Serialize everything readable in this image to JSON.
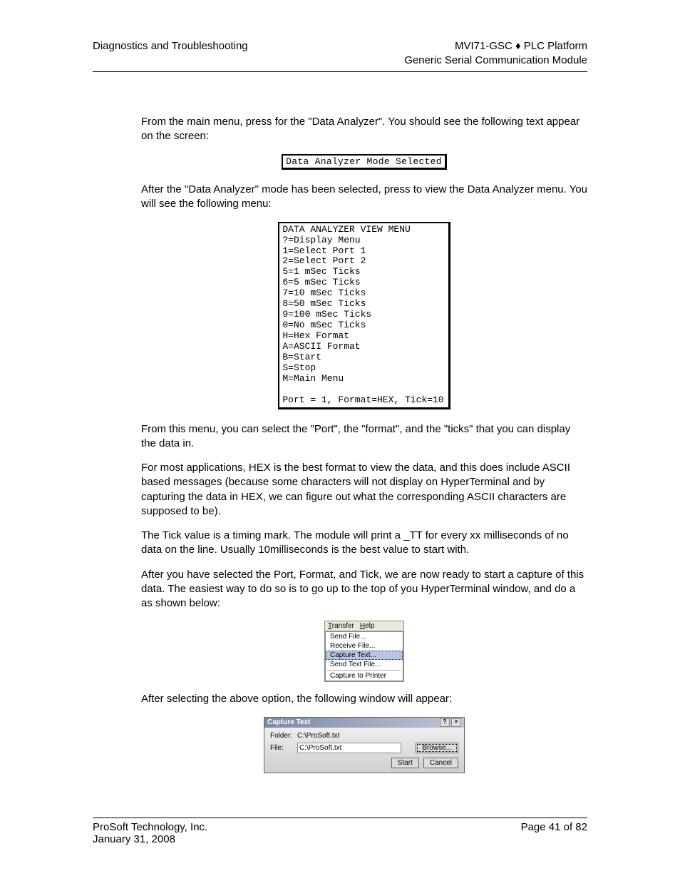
{
  "header": {
    "left": "Diagnostics and Troubleshooting",
    "right_line1": "MVI71-GSC ♦ PLC Platform",
    "right_line2": "Generic Serial Communication Module"
  },
  "para1": "From the main menu, press       for the \"Data Analyzer\". You should see the following text appear on the screen:",
  "terminal1": "Data Analyzer Mode Selected",
  "para2": "After the \"Data Analyzer\" mode has been selected, press       to view the Data Analyzer menu. You will see the following menu:",
  "menu_lines": [
    "DATA ANALYZER VIEW MENU",
    "?=Display Menu",
    "1=Select Port 1",
    "2=Select Port 2",
    "5=1 mSec Ticks",
    "6=5 mSec Ticks",
    "7=10 mSec Ticks",
    "8=50 mSec Ticks",
    "9=100 mSec Ticks",
    "0=No mSec Ticks",
    "H=Hex Format",
    "A=ASCII Format",
    "B=Start",
    "S=Stop",
    "M=Main Menu",
    "",
    "Port = 1, Format=HEX, Tick=10"
  ],
  "para3": "From this menu, you can select the \"Port\", the \"format\", and the \"ticks\" that you can display the data in.",
  "para4": "For most applications, HEX is the best format to view the data, and this does include ASCII based messages (because some characters will not display on HyperTerminal and by capturing the data in HEX, we can figure out what the corresponding ASCII characters are supposed to be).",
  "para5": "The Tick value is a timing mark. The module will print a _TT for every xx milliseconds of no data on the line. Usually 10milliseconds is the best value to start with.",
  "para6": "After you have selected the Port, Format, and Tick, we are now ready to start a capture of this data. The easiest way to do so is to go up to the top of you HyperTerminal window, and do a                                             as shown below:",
  "ht_menu": {
    "bar": [
      "Transfer",
      "Help"
    ],
    "items": [
      "Send File...",
      "Receive File...",
      "Capture Text...",
      "Send Text File..."
    ],
    "selected_index": 2,
    "footer_item": "Capture to Printer"
  },
  "para7": "After selecting the above option, the following window will appear:",
  "capture": {
    "title": "Capture Text",
    "folder_label": "Folder:",
    "folder_value": "C:\\ProSoft.txt",
    "file_label": "File:",
    "file_value": "C:\\ProSoft.txt",
    "browse": "Browse...",
    "start": "Start",
    "cancel": "Cancel"
  },
  "footer": {
    "company": "ProSoft Technology, Inc.",
    "date": "January 31, 2008",
    "page": "Page 41 of 82"
  }
}
